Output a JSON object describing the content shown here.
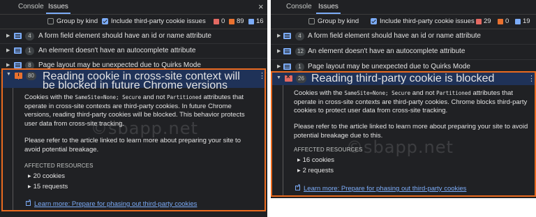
{
  "left": {
    "tabs": [
      "Console",
      "Issues"
    ],
    "close": "×",
    "group_by_kind": "Group by kind",
    "include_third_party": "Include third-party cookie issues",
    "counts": [
      "0",
      "89",
      "16"
    ],
    "rows": [
      {
        "count": "4",
        "title": "A form field element should have an id or name attribute"
      },
      {
        "count": "1",
        "title": "An element doesn't have an autocomplete attribute"
      },
      {
        "count": "8",
        "title": "Page layout may be unexpected due to Quirks Mode"
      }
    ],
    "expanded": {
      "count": "80",
      "title": "Reading cookie in cross-site context will be blocked in future Chrome versions",
      "p1_a": "Cookies with the ",
      "p1_code1": "SameSite=None; Secure",
      "p1_b": " and not ",
      "p1_code2": "Partitioned",
      "p1_c": " attributes that operate in cross-site contexts are third-party cookies. In future Chrome versions, reading third-party cookies will be blocked. This behavior protects user data from cross-site tracking.",
      "p2": "Please refer to the article linked to learn more about preparing your site to avoid potential breakage.",
      "affected_label": "AFFECTED RESOURCES",
      "affected": [
        "20 cookies",
        "15 requests"
      ],
      "link": "Learn more: Prepare for phasing out third-party cookies"
    }
  },
  "right": {
    "tabs": [
      "Console",
      "Issues"
    ],
    "group_by_kind": "Group by kind",
    "include_third_party": "Include third-party cookie issues",
    "counts": [
      "29",
      "0",
      "19"
    ],
    "rows": [
      {
        "count": "4",
        "title": "A form field element should have an id or name attribute"
      },
      {
        "count": "12",
        "title": "An element doesn't have an autocomplete attribute"
      },
      {
        "count": "1",
        "title": "Page layout may be unexpected due to Quirks Mode"
      }
    ],
    "expanded": {
      "count": "26",
      "title": "Reading third-party cookie is blocked",
      "p1_a": "Cookies with the ",
      "p1_code1": "SameSite=None; Secure",
      "p1_b": " and not ",
      "p1_code2": "Partitioned",
      "p1_c": " attributes that operate in cross-site contexts are third-party cookies. Chrome blocks third-party cookies to protect user data from cross-site tracking.",
      "p2": "Please refer to the article linked to learn more about preparing your site to avoid potential breakage due to this.",
      "affected_label": "AFFECTED RESOURCES",
      "affected": [
        "16 cookies",
        "2 requests"
      ],
      "link": "Learn more: Prepare for phasing out third-party cookies"
    }
  },
  "watermark": "©sbapp.net",
  "colors": {
    "accent": "#7cacf8",
    "highlight_border": "#ea6a1f",
    "error": "#e46962",
    "warning": "#e9712f"
  }
}
